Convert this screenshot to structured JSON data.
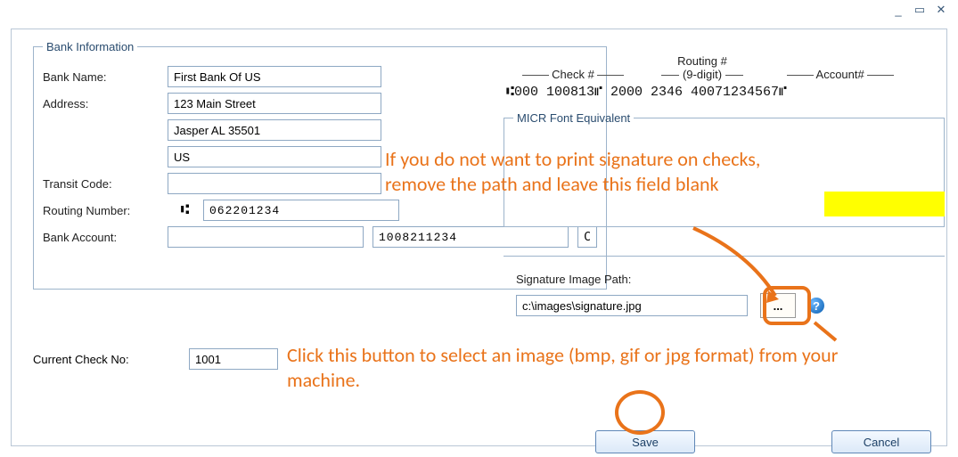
{
  "titlebar": {
    "min": "_",
    "max": "▭",
    "close": "✕"
  },
  "bank_group": {
    "legend": "Bank Information",
    "bank_name_label": "Bank Name:",
    "bank_name_value": "First Bank Of US",
    "address_label": "Address:",
    "address_line1": "123 Main Street",
    "address_line2": "Jasper AL 35501",
    "address_line3": "US",
    "transit_label": "Transit Code:",
    "transit_value": "",
    "routing_label": "Routing Number:",
    "routing_prefix_symbol": "⑆",
    "routing_value": "062201234",
    "bankacct_label": "Bank Account:",
    "bankacct_prefix": "",
    "bankacct_value": "1008211234",
    "bankacct_suffix": "C"
  },
  "current_check": {
    "label": "Current Check No:",
    "value": "1001"
  },
  "acct_labels": {
    "check_label": "Check #",
    "routing_label_top": "Routing #",
    "routing_label_sub": "(9-digit)",
    "account_label": "Account#",
    "sample_line": "⑆000 100813⑈ 2000 2346  40071234567⑈"
  },
  "micr_group": {
    "legend": "MICR Font Equivalent"
  },
  "sig": {
    "label": "Signature Image Path:",
    "value": "c:\\images\\signature.jpg",
    "browse_label": "...",
    "help_icon": "?"
  },
  "annotations": {
    "top_note": "If you do not want to print signature on checks, remove the path and leave this field blank",
    "bottom_note": "Click this button to select an image (bmp, gif or jpg format) from your machine."
  },
  "buttons": {
    "save": "Save",
    "cancel": "Cancel"
  }
}
